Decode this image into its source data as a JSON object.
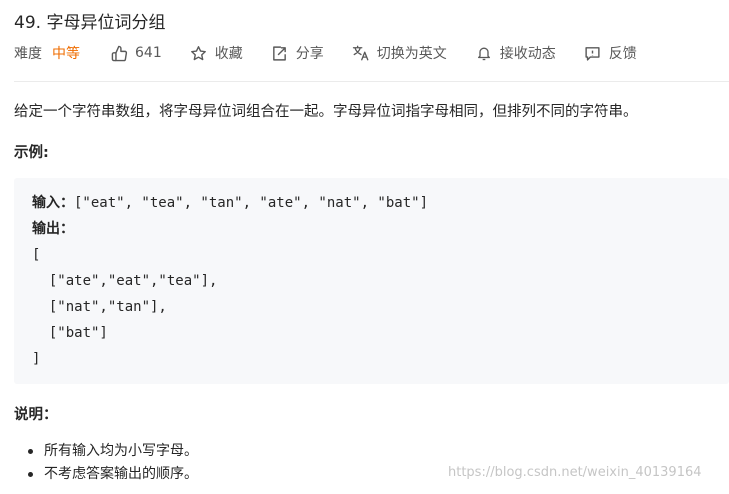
{
  "problem": {
    "title": "49. 字母异位词分组",
    "difficulty_label": "难度",
    "difficulty_value": "中等",
    "likes": "641",
    "favorite_label": "收藏",
    "share_label": "分享",
    "translate_label": "切换为英文",
    "notify_label": "接收动态",
    "feedback_label": "反馈"
  },
  "description": "给定一个字符串数组，将字母异位词组合在一起。字母异位词指字母相同，但排列不同的字符串。",
  "example": {
    "heading": "示例:",
    "input_label": "输入：",
    "input_value": "[\"eat\", \"tea\", \"tan\", \"ate\", \"nat\", \"bat\"]",
    "output_label": "输出：",
    "output_lines": [
      "[",
      "  [\"ate\",\"eat\",\"tea\"],",
      "  [\"nat\",\"tan\"],",
      "  [\"bat\"]",
      "]"
    ]
  },
  "notes": {
    "heading": "说明：",
    "items": [
      "所有输入均为小写字母。",
      "不考虑答案输出的顺序。"
    ]
  },
  "watermark": "https://blog.csdn.net/weixin_40139164",
  "colors": {
    "difficulty_medium": "#ef6c00",
    "text": "#262626",
    "muted": "#595959",
    "code_bg": "#f7f8fa"
  },
  "icons": [
    "thumbs-up-icon",
    "star-icon",
    "share-icon",
    "translate-icon",
    "bell-icon",
    "feedback-icon"
  ]
}
